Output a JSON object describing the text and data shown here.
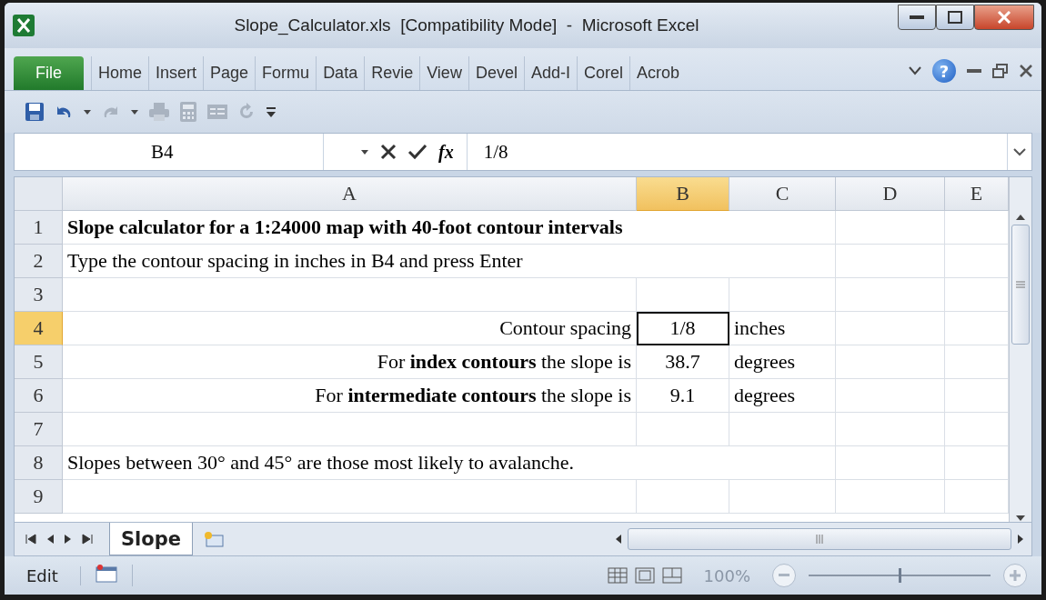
{
  "window": {
    "title": "Slope_Calculator.xls  [Compatibility Mode]  -  Microsoft Excel"
  },
  "ribbon": {
    "file_tab": "File",
    "tabs": [
      "Home",
      "Insert",
      "Page",
      "Formu",
      "Data",
      "Revie",
      "View",
      "Devel",
      "Add-I",
      "Corel",
      "Acrob"
    ],
    "help": "?"
  },
  "formula_bar": {
    "name_box": "B4",
    "function_label": "fx",
    "formula": "1/8"
  },
  "grid": {
    "columns": [
      {
        "label": "A",
        "selected": false
      },
      {
        "label": "B",
        "selected": true
      },
      {
        "label": "C",
        "selected": false
      },
      {
        "label": "D",
        "selected": false
      },
      {
        "label": "E",
        "selected": false
      }
    ],
    "rows": [
      {
        "number": "1",
        "selected": false,
        "cells": [
          {
            "text": "Slope calculator for a 1:24000 map with 40-foot contour intervals",
            "bold": true
          }
        ]
      },
      {
        "number": "2",
        "selected": false,
        "cells": [
          {
            "text": "Type the contour spacing in inches in B4 and press Enter",
            "bold": false
          }
        ]
      },
      {
        "number": "3",
        "selected": false
      },
      {
        "number": "4",
        "selected": true,
        "cells": [
          {
            "text": "Contour spacing",
            "bold": false
          },
          {
            "text": "1/8",
            "bold": false
          },
          {
            "text": "inches",
            "bold": false
          }
        ]
      },
      {
        "number": "5",
        "selected": false,
        "cells": [
          {
            "text": "For **index contours** the slope is",
            "bold": false
          },
          {
            "text": "38.7",
            "bold": false
          },
          {
            "text": "degrees",
            "bold": false
          }
        ]
      },
      {
        "number": "6",
        "selected": false,
        "cells": [
          {
            "text": "For **intermediate contours** the slope is",
            "bold": false
          },
          {
            "text": "9.1",
            "bold": false
          },
          {
            "text": "degrees",
            "bold": false
          }
        ]
      },
      {
        "number": "7",
        "selected": false
      },
      {
        "number": "8",
        "selected": false,
        "cells": [
          {
            "text": "Slopes between 30° and 45° are those most likely to avalanche.",
            "bold": false
          }
        ]
      },
      {
        "number": "9",
        "selected": false
      }
    ]
  },
  "sheet_tabs": [
    {
      "label": "Slope",
      "selected": true
    }
  ],
  "status_bar": {
    "mode": "Edit",
    "zoom": "100%",
    "zoom_slider": {
      "level": 0.5
    }
  }
}
